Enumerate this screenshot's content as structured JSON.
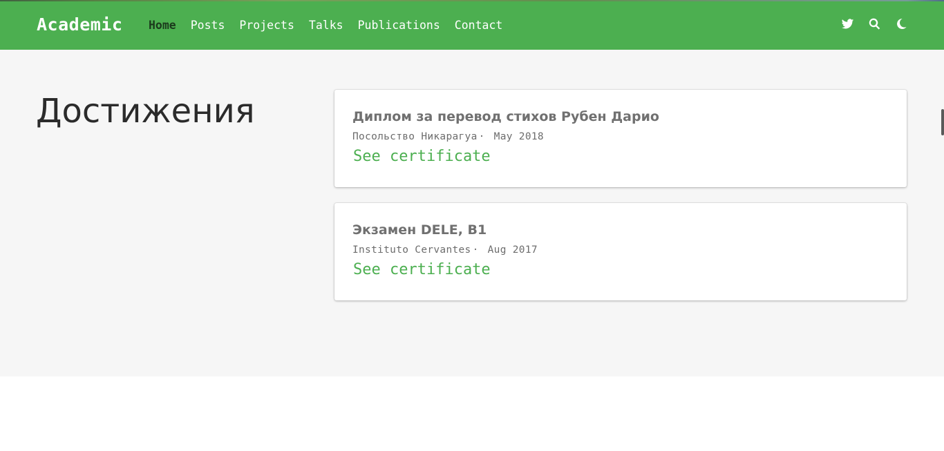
{
  "navbar": {
    "brand": "Academic",
    "links": [
      {
        "label": "Home",
        "active": true
      },
      {
        "label": "Posts"
      },
      {
        "label": "Projects"
      },
      {
        "label": "Talks"
      },
      {
        "label": "Publications"
      },
      {
        "label": "Contact"
      }
    ],
    "icons": [
      "twitter-icon",
      "search-icon",
      "moon-icon"
    ],
    "background_color": "#4caf50"
  },
  "section": {
    "title": "Достижения"
  },
  "accomplishments": [
    {
      "title": "Диплом за перевод стихов Рубен Дарио",
      "organization": "Посольство Никарагуа",
      "separator": "·",
      "date": "May 2018",
      "link_label": "See certificate"
    },
    {
      "title": "Экзамен DELE, B1",
      "organization": "Instituto Cervantes",
      "separator": "·",
      "date": "Aug 2017",
      "link_label": "See certificate"
    }
  ],
  "colors": {
    "accent": "#4caf50",
    "page_background": "#f6f6f6"
  }
}
